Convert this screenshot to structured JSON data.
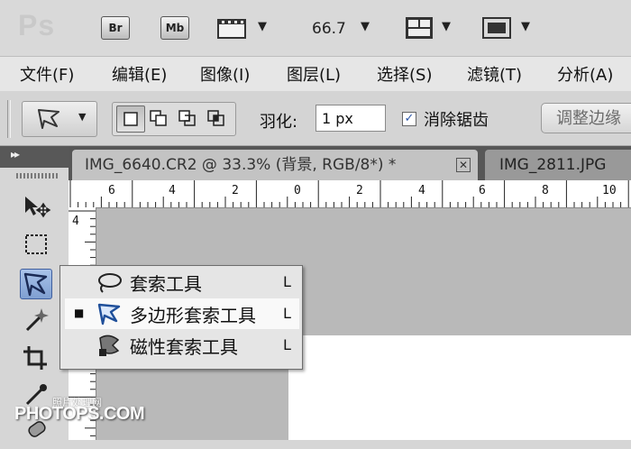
{
  "app": {
    "logo": "Ps",
    "bridge_label": "Br",
    "minibridge_label": "Mb",
    "zoom_value": "66.7"
  },
  "menu": [
    "文件(F)",
    "编辑(E)",
    "图像(I)",
    "图层(L)",
    "选择(S)",
    "滤镜(T)",
    "分析(A)"
  ],
  "options": {
    "feather_label": "羽化:",
    "feather_value": "1 px",
    "antialias_label": "消除锯齿",
    "antialias_checked": true,
    "refine_edge_label": "调整边缘"
  },
  "tabs": [
    {
      "label": "IMG_6640.CR2 @ 33.3% (背景, RGB/8*) *",
      "active": true
    },
    {
      "label": "IMG_2811.JPG",
      "active": false
    }
  ],
  "ruler": {
    "horizontal_labels": [
      "6",
      "4",
      "2",
      "0",
      "2",
      "4",
      "6",
      "8",
      "10"
    ],
    "vertical_labels": [
      "4"
    ]
  },
  "flyout": {
    "items": [
      {
        "label": "套索工具",
        "shortcut": "L",
        "current": false
      },
      {
        "label": "多边形套索工具",
        "shortcut": "L",
        "current": true
      },
      {
        "label": "磁性套索工具",
        "shortcut": "L",
        "current": false
      }
    ],
    "current_marker": "■"
  },
  "watermark": {
    "small": "照片处理网",
    "big": "PHOTOPS.COM"
  },
  "colors": {
    "active_tool_bg": "#8fb0df",
    "workspace": "#b9b9b9",
    "tab_strip": "#575757"
  }
}
